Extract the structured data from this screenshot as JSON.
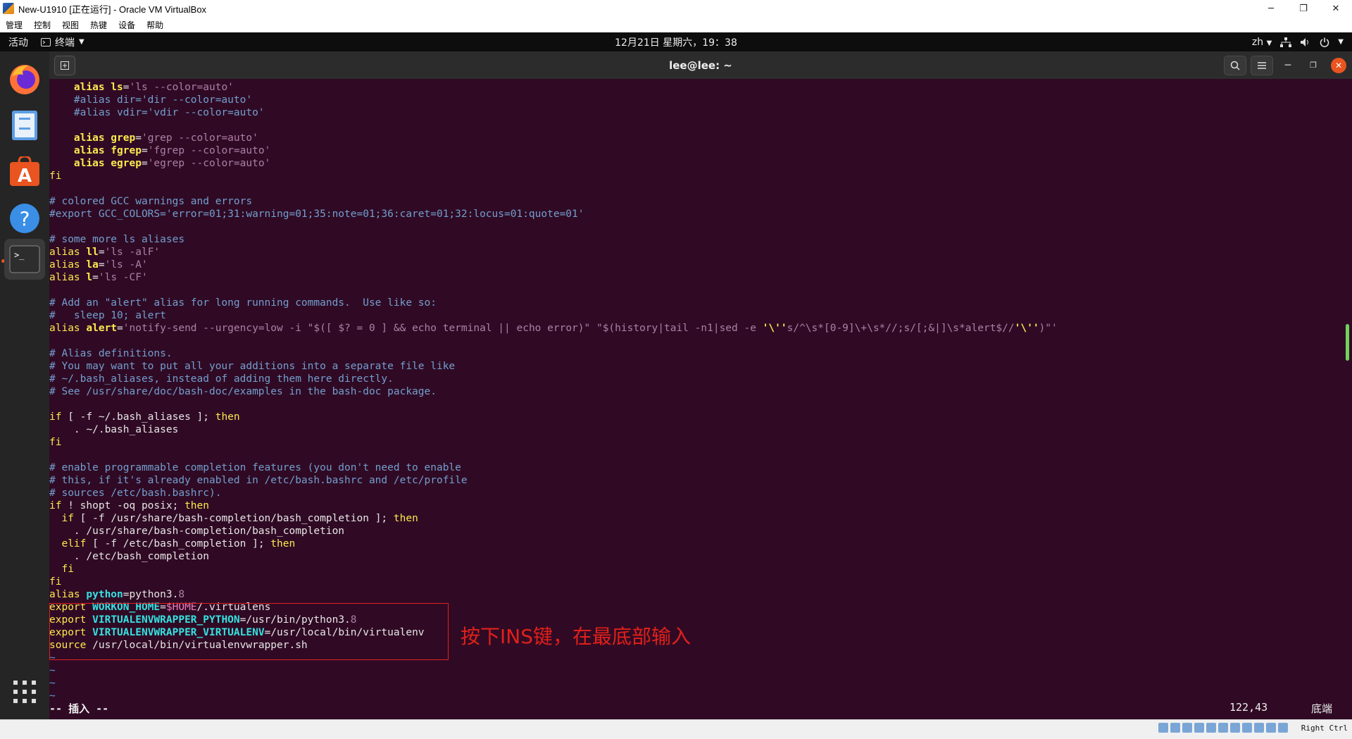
{
  "window": {
    "title": "New-U1910 [正在运行] - Oracle VM VirtualBox",
    "minimize": "─",
    "restore": "❐",
    "close": "✕"
  },
  "vbox_menu": [
    "管理",
    "控制",
    "视图",
    "热键",
    "设备",
    "帮助"
  ],
  "topbar": {
    "activities": "活动",
    "app_menu": "终端",
    "clock": "12月21日 星期六，19：38",
    "lang": "zh"
  },
  "terminal": {
    "title": "lee@lee: ~"
  },
  "annotation": "按下INS键，在最底部输入",
  "status": {
    "mode": "-- 插入 --",
    "position": "122,43",
    "location": "底端"
  },
  "vbox_status": {
    "host_key": "Right Ctrl"
  },
  "colors": {
    "terminal_bg": "#300a24",
    "accent": "#e95420",
    "annotation": "#e0201a"
  },
  "icons": [
    "firefox-icon",
    "files-icon",
    "software-center-icon",
    "help-icon",
    "terminal-icon",
    "app-grid-icon",
    "search-icon",
    "hamburger-menu-icon",
    "network-icon",
    "volume-icon",
    "power-icon"
  ]
}
